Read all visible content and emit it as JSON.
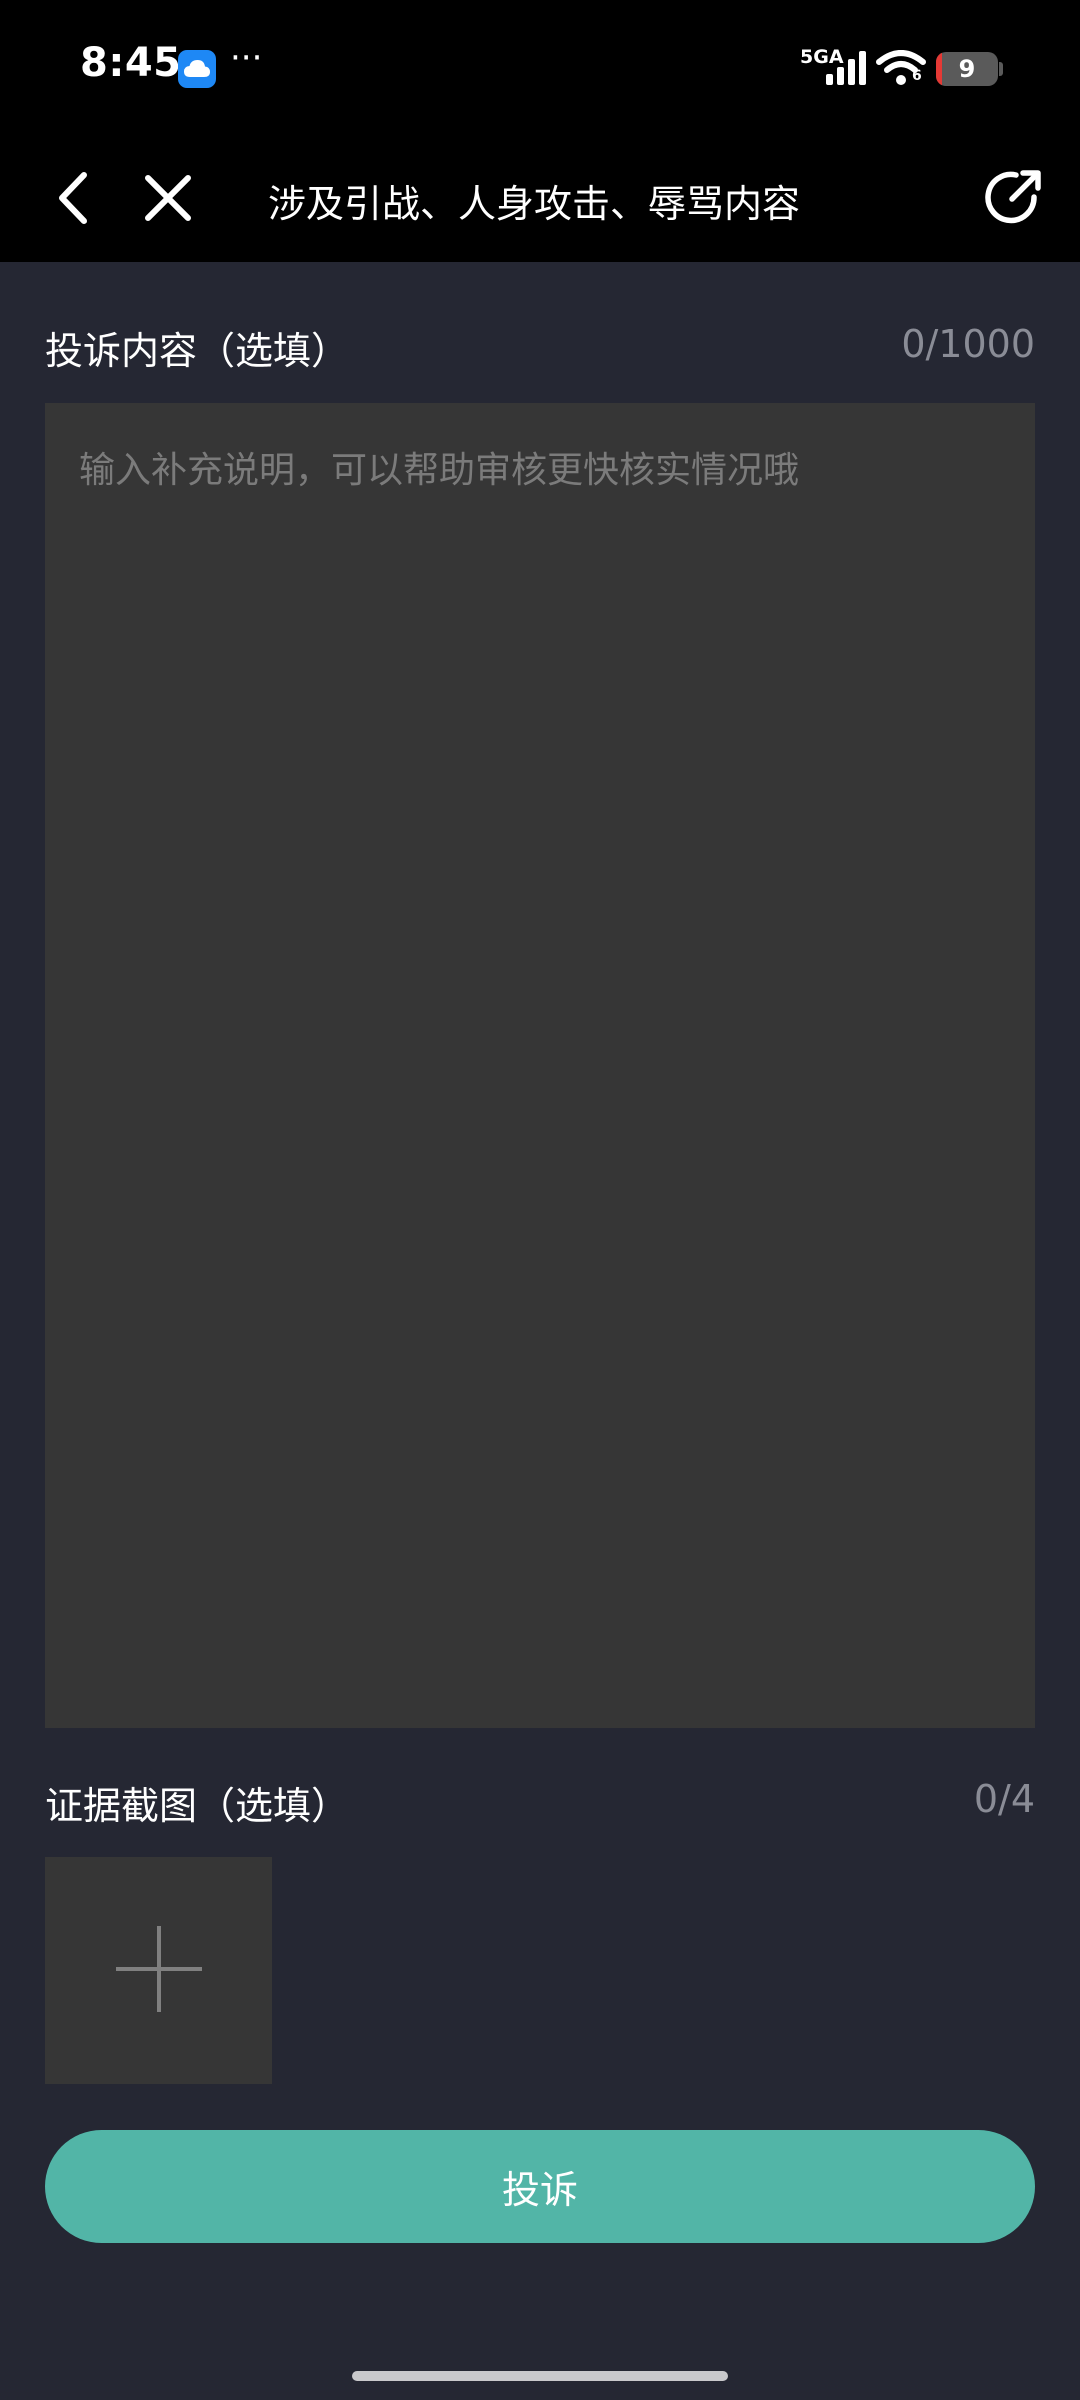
{
  "status_bar": {
    "time": "8:45",
    "app_icon": "cloud-icon",
    "more": "···",
    "network": "5GA",
    "wifi_sub": "6",
    "battery_level": "9",
    "colors": {
      "battery_low": "#e53935",
      "app_icon_bg": "#1e88f5"
    }
  },
  "nav": {
    "title": "涉及引战、人身攻击、辱骂内容",
    "back_icon": "chevron-left-icon",
    "close_icon": "close-icon",
    "share_icon": "share-icon"
  },
  "complaint": {
    "label": "投诉内容（选填）",
    "counter": "0/1000",
    "value": "",
    "placeholder": "输入补充说明，可以帮助审核更快核实情况哦"
  },
  "evidence": {
    "label": "证据截图（选填）",
    "counter": "0/4",
    "add_icon": "plus-icon"
  },
  "submit": {
    "label": "投诉",
    "color": "#52b5a7"
  },
  "theme": {
    "background": "#252733",
    "input_bg": "#363636",
    "bar_bg": "#000000"
  }
}
